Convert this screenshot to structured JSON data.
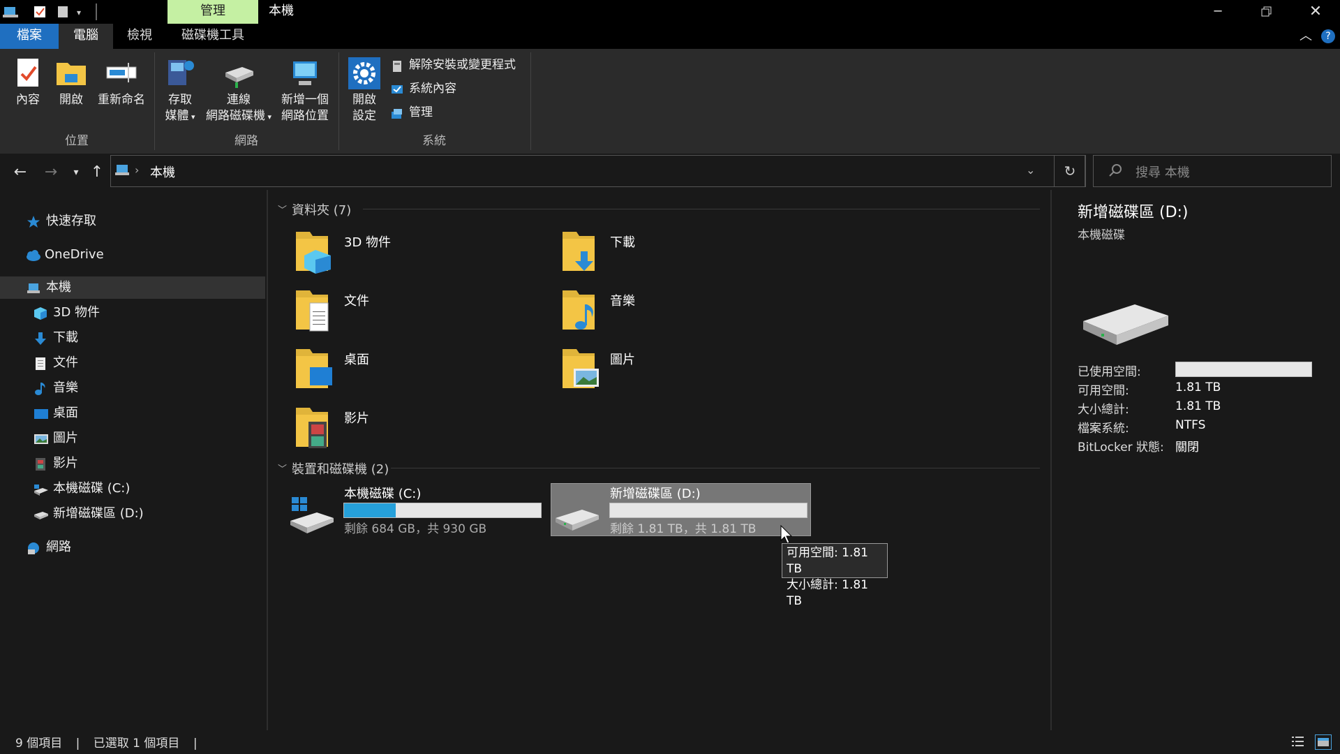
{
  "window": {
    "context_tab": "管理",
    "title": "本機",
    "help_glyph": "?"
  },
  "tabs": [
    "檔案",
    "電腦",
    "檢視",
    "磁碟機工具"
  ],
  "ribbon": {
    "location": {
      "label": "位置",
      "buttons": [
        {
          "label": "內容"
        },
        {
          "label": "開啟"
        },
        {
          "label": "重新命名"
        }
      ]
    },
    "network": {
      "label": "網路",
      "buttons": [
        {
          "line1": "存取",
          "line2": "媒體"
        },
        {
          "line1": "連線",
          "line2": "網路磁碟機"
        },
        {
          "line1": "新增一個",
          "line2": "網路位置"
        }
      ]
    },
    "system": {
      "label": "系統",
      "open_settings": {
        "line1": "開啟",
        "line2": "設定"
      },
      "commands": [
        "解除安裝或變更程式",
        "系統內容",
        "管理"
      ]
    }
  },
  "address": {
    "path": "本機",
    "search_placeholder": "搜尋 本機"
  },
  "nav": {
    "quick_access": "快速存取",
    "onedrive": "OneDrive",
    "this_pc": "本機",
    "children": [
      "3D 物件",
      "下載",
      "文件",
      "音樂",
      "桌面",
      "圖片",
      "影片",
      "本機磁碟 (C:)",
      "新增磁碟區 (D:)"
    ],
    "network": "網路"
  },
  "content": {
    "folders_header": "資料夾 (7)",
    "folders": [
      "3D 物件",
      "下載",
      "文件",
      "音樂",
      "桌面",
      "圖片",
      "影片"
    ],
    "drives_header": "裝置和磁碟機 (2)",
    "drives": [
      {
        "name": "本機磁碟 (C:)",
        "free_text": "剩餘 684 GB，共 930 GB",
        "used_fraction": 0.264
      },
      {
        "name": "新增磁碟區 (D:)",
        "free_text": "剩餘 1.81 TB，共 1.81 TB",
        "used_fraction": 0.0
      }
    ]
  },
  "tooltip": {
    "line1": "可用空間: 1.81 TB",
    "line2": "大小總計: 1.81 TB"
  },
  "details": {
    "title": "新增磁碟區 (D:)",
    "subtitle": "本機磁碟",
    "used_label": "已使用空間:",
    "used_fraction": 0.0,
    "free_label": "可用空間:",
    "free_value": "1.81 TB",
    "total_label": "大小總計:",
    "total_value": "1.81 TB",
    "fs_label": "檔案系統:",
    "fs_value": "NTFS",
    "bitlocker_label": "BitLocker 狀態:",
    "bitlocker_value": "關閉"
  },
  "status": {
    "items": "9 個項目",
    "selected": "已選取 1 個項目",
    "separator": "|"
  },
  "colors": {
    "accent": "#1f6fc0",
    "context_tab": "#c5f0a3",
    "drive_fill": "#26a0da",
    "folder": "#f3c545"
  }
}
